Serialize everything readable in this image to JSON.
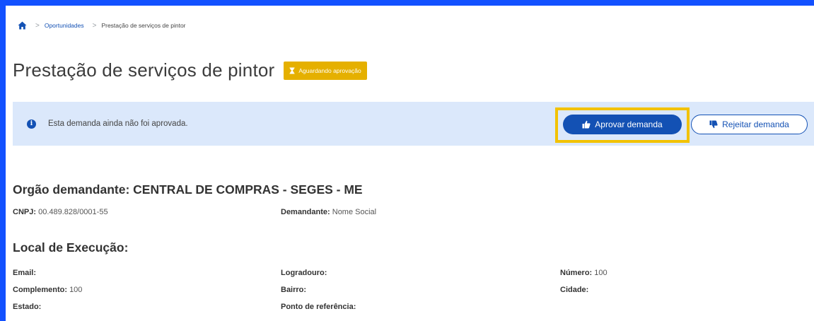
{
  "breadcrumb": {
    "items": [
      "Oportunidades",
      "Prestação de serviços de pintor"
    ],
    "separator": ">"
  },
  "header": {
    "title": "Prestação de serviços de pintor",
    "status_badge": "Aguardando aprovação"
  },
  "alert": {
    "icon": "info-icon",
    "message": "Esta demanda ainda não foi aprovada.",
    "approve_label": "Aprovar demanda",
    "reject_label": "Rejeitar demanda"
  },
  "orgao": {
    "heading": "Orgão demandante: CENTRAL DE COMPRAS - SEGES - ME",
    "cnpj_label": "CNPJ:",
    "cnpj_value": "00.489.828/0001-55",
    "demandante_label": "Demandante:",
    "demandante_value": "Nome Social"
  },
  "local": {
    "heading": "Local de Execução:",
    "fields": [
      {
        "label": "Email:",
        "value": ""
      },
      {
        "label": "Logradouro:",
        "value": ""
      },
      {
        "label": "Número:",
        "value": "100"
      },
      {
        "label": "Complemento:",
        "value": "100"
      },
      {
        "label": "Bairro:",
        "value": ""
      },
      {
        "label": "Cidade:",
        "value": ""
      },
      {
        "label": "Estado:",
        "value": ""
      },
      {
        "label": "Ponto de referência:",
        "value": ""
      }
    ]
  },
  "colors": {
    "frame": "#1351ff",
    "primary": "#1351b4",
    "badge": "#e5b000",
    "alert_bg": "#dbe8fb",
    "highlight": "#f2c200"
  }
}
